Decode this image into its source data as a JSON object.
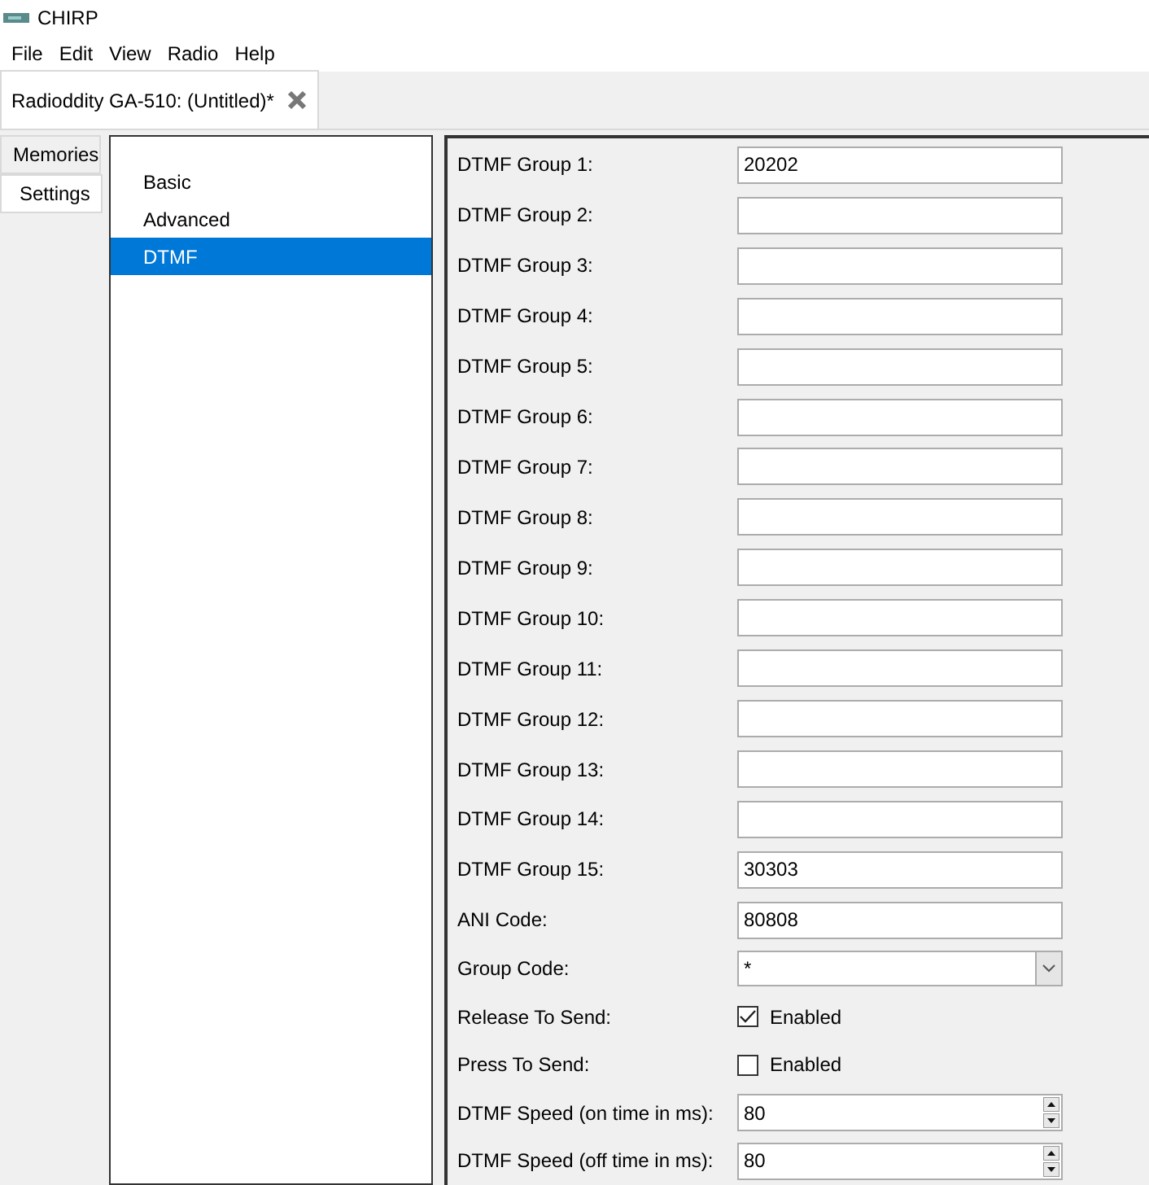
{
  "window": {
    "title": "CHIRP"
  },
  "menu": [
    "File",
    "Edit",
    "View",
    "Radio",
    "Help"
  ],
  "document_tabs": [
    {
      "label": "Radioddity GA-510: (Untitled)*",
      "selected": true
    }
  ],
  "side_tabs": [
    {
      "label": "Memories",
      "selected": false
    },
    {
      "label": "Settings",
      "selected": true
    }
  ],
  "settings_tree": [
    {
      "label": "Basic",
      "selected": false
    },
    {
      "label": "Advanced",
      "selected": false
    },
    {
      "label": "DTMF",
      "selected": true
    }
  ],
  "fields": [
    {
      "kind": "text",
      "label": "DTMF Group 1:",
      "value": "20202"
    },
    {
      "kind": "text",
      "label": "DTMF Group 2:"
    },
    {
      "kind": "text",
      "label": "DTMF Group 3:"
    },
    {
      "kind": "text",
      "label": "DTMF Group 4:"
    },
    {
      "kind": "text",
      "label": "DTMF Group 5:"
    },
    {
      "kind": "text",
      "label": "DTMF Group 6:"
    },
    {
      "kind": "text",
      "label": "DTMF Group 7:"
    },
    {
      "kind": "text",
      "label": "DTMF Group 8:"
    },
    {
      "kind": "text",
      "label": "DTMF Group 9:"
    },
    {
      "kind": "text",
      "label": "DTMF Group 10:"
    },
    {
      "kind": "text",
      "label": "DTMF Group 11:"
    },
    {
      "kind": "text",
      "label": "DTMF Group 12:"
    },
    {
      "kind": "text",
      "label": "DTMF Group 13:"
    },
    {
      "kind": "text",
      "label": "DTMF Group 14:"
    },
    {
      "kind": "text",
      "label": "DTMF Group 15:",
      "value": "30303"
    },
    {
      "kind": "text",
      "label": "ANI Code:",
      "value": "80808"
    },
    {
      "kind": "combo",
      "label": "Group Code:",
      "value": "*"
    },
    {
      "kind": "checkbox",
      "label": "Release To Send:",
      "text": "Enabled",
      "checked": true
    },
    {
      "kind": "checkbox",
      "label": "Press To Send:",
      "text": "Enabled",
      "checked": false
    },
    {
      "kind": "spin",
      "label": "DTMF Speed (on time in ms):",
      "value": "80"
    },
    {
      "kind": "spin",
      "label": "DTMF Speed (off time in ms):",
      "value": "80"
    }
  ]
}
